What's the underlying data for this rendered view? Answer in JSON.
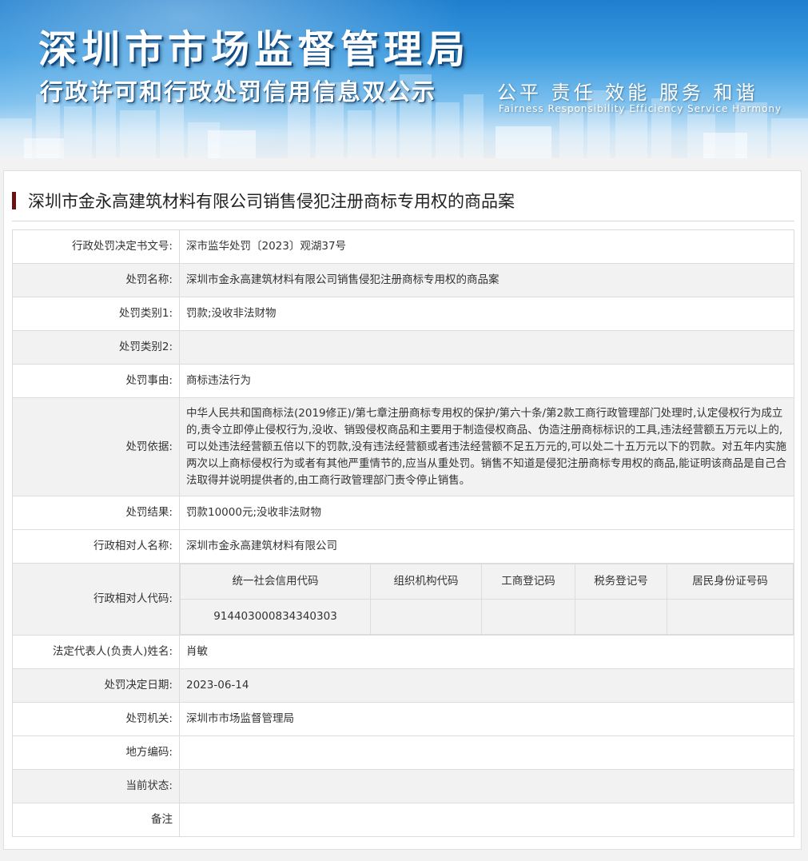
{
  "banner": {
    "title": "深圳市市场监督管理局",
    "subtitle": "行政许可和行政处罚信用信息双公示",
    "values": "公平 责任 效能 服务 和谐",
    "values_en": "Fairness Responsibility Efficiency Service Harmony"
  },
  "case_title": "深圳市金永高建筑材料有限公司销售侵犯注册商标专用权的商品案",
  "rows": {
    "decision_no": {
      "label": "行政处罚决定书文号:",
      "value": "深市监华处罚〔2023〕观湖37号"
    },
    "case_name": {
      "label": "处罚名称:",
      "value": "深圳市金永高建筑材料有限公司销售侵犯注册商标专用权的商品案"
    },
    "category1": {
      "label": "处罚类别1:",
      "value": "罚款;没收非法财物"
    },
    "category2": {
      "label": "处罚类别2:",
      "value": ""
    },
    "reason": {
      "label": "处罚事由:",
      "value": "商标违法行为"
    },
    "basis": {
      "label": "处罚依据:",
      "value": "中华人民共和国商标法(2019修正)/第七章注册商标专用权的保护/第六十条/第2款工商行政管理部门处理时,认定侵权行为成立的,责令立即停止侵权行为,没收、销毁侵权商品和主要用于制造侵权商品、伪造注册商标标识的工具,违法经营额五万元以上的,可以处违法经营额五倍以下的罚款,没有违法经营额或者违法经营额不足五万元的,可以处二十五万元以下的罚款。对五年内实施两次以上商标侵权行为或者有其他严重情节的,应当从重处罚。销售不知道是侵犯注册商标专用权的商品,能证明该商品是自己合法取得并说明提供者的,由工商行政管理部门责令停止销售。"
    },
    "result": {
      "label": "处罚结果:",
      "value": "罚款10000元;没收非法财物"
    },
    "party_name": {
      "label": "行政相对人名称:",
      "value": "深圳市金永高建筑材料有限公司"
    },
    "party_code": {
      "label": "行政相对人代码:",
      "headers": [
        "统一社会信用代码",
        "组织机构代码",
        "工商登记码",
        "税务登记号",
        "居民身份证号码"
      ],
      "values": [
        "914403000834340303",
        "",
        "",
        "",
        ""
      ]
    },
    "legal_rep": {
      "label": "法定代表人(负责人)姓名:",
      "value": "肖敏"
    },
    "decision_date": {
      "label": "处罚决定日期:",
      "value": "2023-06-14"
    },
    "authority": {
      "label": "处罚机关:",
      "value": "深圳市市场监督管理局"
    },
    "region_code": {
      "label": "地方编码:",
      "value": ""
    },
    "status": {
      "label": "当前状态:",
      "value": ""
    },
    "remark": {
      "label": "备注",
      "value": ""
    }
  }
}
